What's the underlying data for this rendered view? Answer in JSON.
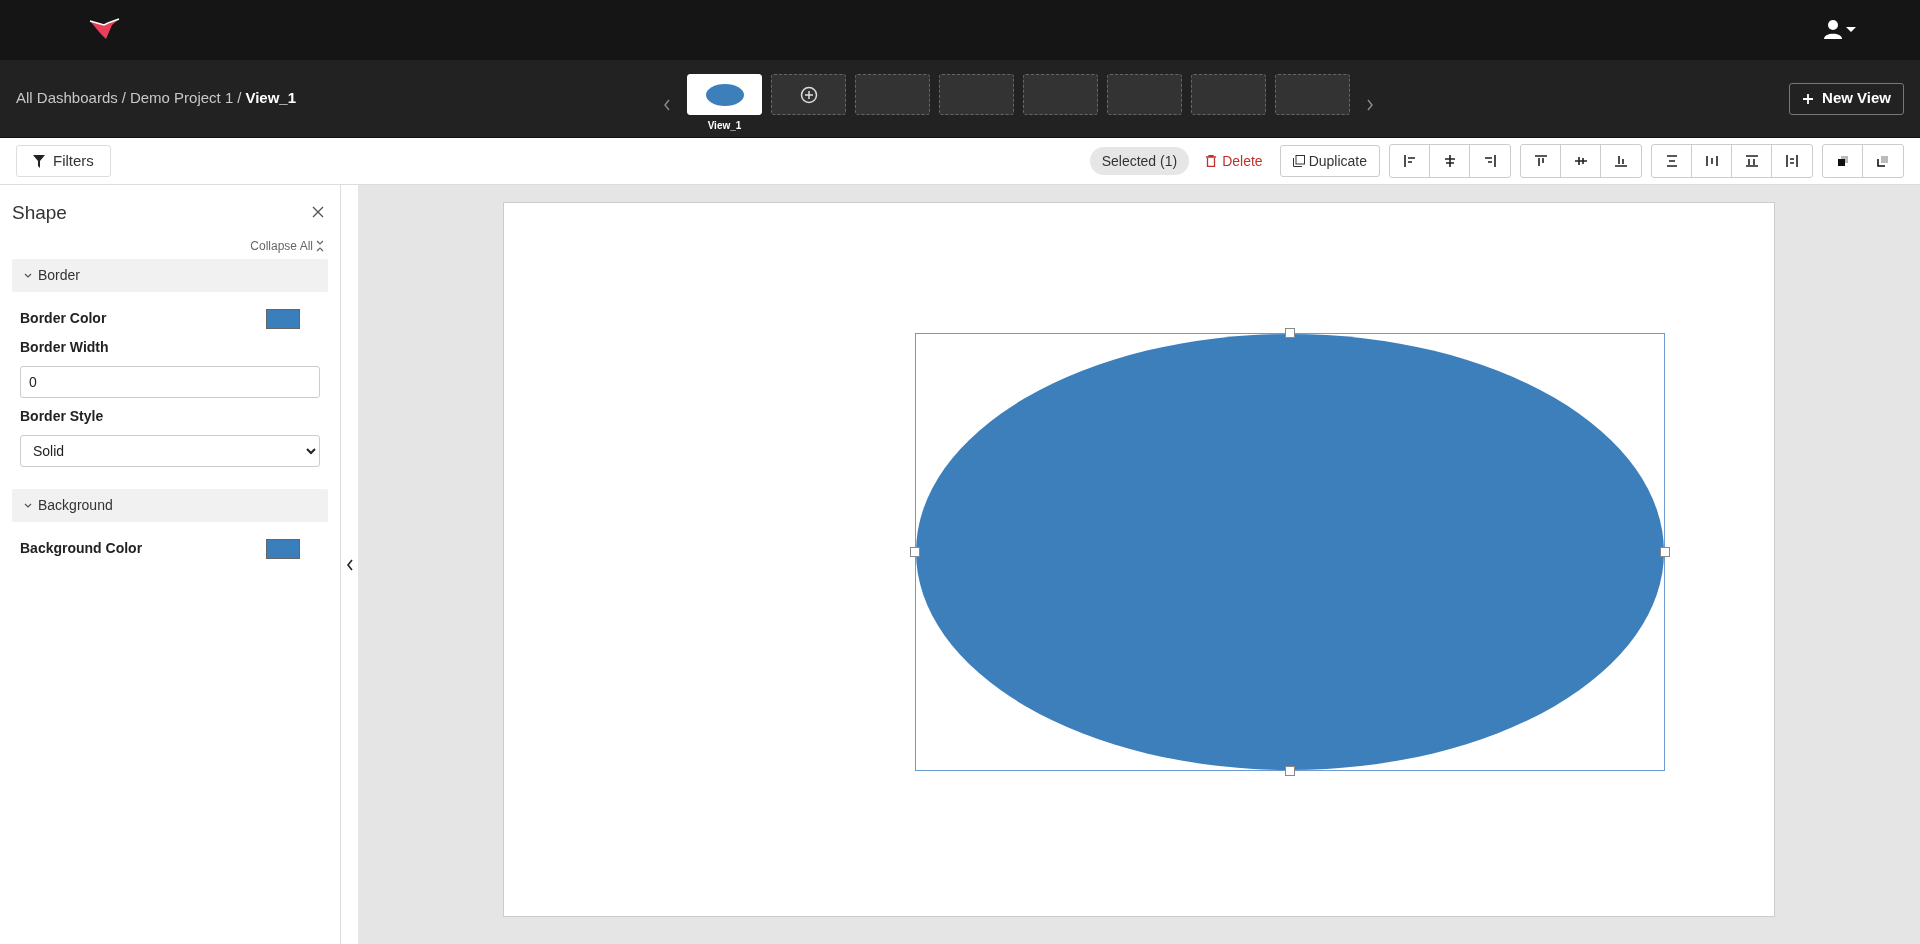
{
  "breadcrumb_separator": "/",
  "breadcrumb": [
    {
      "label": "All Dashboards",
      "current": false
    },
    {
      "label": "Demo Project 1",
      "current": false
    },
    {
      "label": "View_1",
      "current": true
    }
  ],
  "views": [
    {
      "kind": "shape",
      "label": "View_1",
      "selected": true
    },
    {
      "kind": "add",
      "selected": false
    },
    {
      "kind": "empty",
      "selected": false
    },
    {
      "kind": "empty",
      "selected": false
    },
    {
      "kind": "empty",
      "selected": false
    },
    {
      "kind": "empty",
      "selected": false
    },
    {
      "kind": "empty",
      "selected": false
    },
    {
      "kind": "empty",
      "selected": false
    }
  ],
  "new_view_button": "New View",
  "toolbar": {
    "filters": "Filters",
    "selected": "Selected (1)",
    "delete": "Delete",
    "duplicate": "Duplicate",
    "groups": [
      [
        {
          "kind": "align-left"
        },
        {
          "kind": "align-center"
        },
        {
          "kind": "align-right"
        }
      ],
      [
        {
          "kind": "align-top"
        },
        {
          "kind": "align-middle"
        },
        {
          "kind": "align-bottom"
        }
      ],
      [
        {
          "kind": "distribute-vertical"
        },
        {
          "kind": "distribute-horizontal"
        },
        {
          "kind": "distribute-top"
        },
        {
          "kind": "distribute-left"
        }
      ],
      [
        {
          "kind": "bring-front"
        },
        {
          "kind": "send-back"
        }
      ]
    ]
  },
  "panel": {
    "title": "Shape",
    "collapse_all": "Collapse All",
    "sections": [
      {
        "title": "Border",
        "expanded": true,
        "fields": [
          {
            "kind": "color",
            "label": "Border Color",
            "color": "#3a7ebb"
          },
          {
            "kind": "input",
            "label": "Border Width",
            "value": "0"
          },
          {
            "kind": "select",
            "label": "Border Style",
            "value": "Solid"
          }
        ]
      },
      {
        "title": "Background",
        "expanded": true,
        "fields": [
          {
            "kind": "color",
            "label": "Background Color",
            "color": "#3a7ebb"
          }
        ]
      }
    ]
  },
  "canvas": {
    "shape": {
      "kind": "ellipse",
      "color": "#3c7fbb",
      "selected": true
    }
  }
}
